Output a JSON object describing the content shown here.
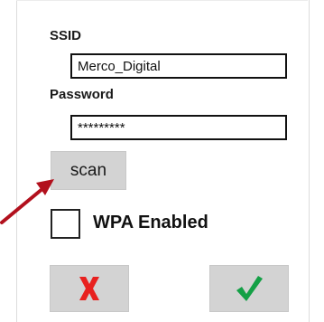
{
  "form": {
    "ssid_label": "SSID",
    "ssid_value": "Merco_Digital",
    "password_label": "Password",
    "password_value": "*********",
    "scan_label": "scan",
    "wpa_label": "WPA Enabled",
    "wpa_checked": false
  },
  "actions": {
    "cancel_icon": "x-icon",
    "confirm_icon": "check-icon"
  },
  "colors": {
    "cancel_red": "#e8211f",
    "confirm_green": "#14a046",
    "arrow_red": "#b2101d",
    "button_gray": "#d3d3d3"
  }
}
